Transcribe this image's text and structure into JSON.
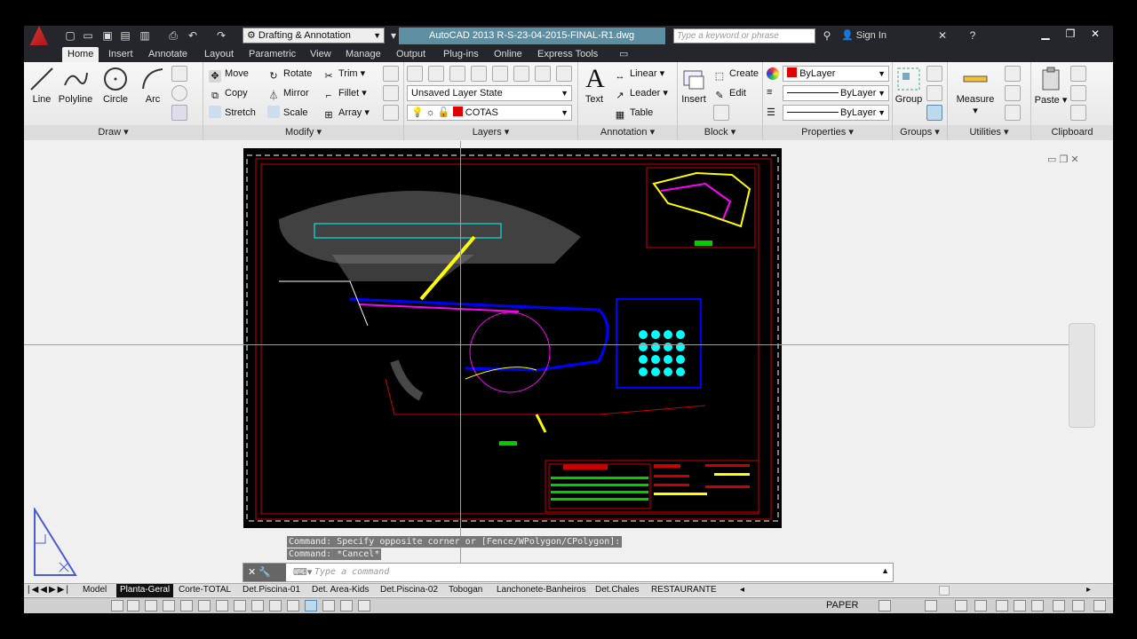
{
  "titlebar": {
    "workspace": "Drafting & Annotation",
    "app_title": "AutoCAD 2013   R-S-23-04-2015-FINAL-R1.dwg",
    "search_placeholder": "Type a keyword or phrase",
    "signin": "Sign In"
  },
  "tabs": [
    "Home",
    "Insert",
    "Annotate",
    "Layout",
    "Parametric",
    "View",
    "Manage",
    "Output",
    "Plug-ins",
    "Online",
    "Express Tools"
  ],
  "ribbon": {
    "draw": {
      "title": "Draw",
      "line": "Line",
      "polyline": "Polyline",
      "circle": "Circle",
      "arc": "Arc"
    },
    "modify": {
      "title": "Modify",
      "move": "Move",
      "rotate": "Rotate",
      "trim": "Trim",
      "copy": "Copy",
      "mirror": "Mirror",
      "fillet": "Fillet",
      "stretch": "Stretch",
      "scale": "Scale",
      "array": "Array"
    },
    "layers": {
      "title": "Layers",
      "layer_state": "Unsaved Layer State",
      "current_layer": "COTAS"
    },
    "annotation": {
      "title": "Annotation",
      "text": "Text",
      "linear": "Linear",
      "leader": "Leader",
      "table": "Table"
    },
    "block": {
      "title": "Block",
      "insert": "Insert",
      "create": "Create",
      "edit": "Edit"
    },
    "properties": {
      "title": "Properties",
      "color": "ByLayer",
      "linetype": "ByLayer",
      "lineweight": "ByLayer"
    },
    "groups": {
      "title": "Groups",
      "group": "Group"
    },
    "utilities": {
      "title": "Utilities",
      "measure": "Measure"
    },
    "clipboard": {
      "title": "Clipboard",
      "paste": "Paste"
    }
  },
  "history": [
    "Command: Specify opposite corner or [Fence/WPolygon/CPolygon]:",
    "Command: *Cancel*"
  ],
  "command": {
    "placeholder": "Type a command"
  },
  "layout_tabs": [
    "Model",
    "Planta-Geral",
    "Corte-TOTAL",
    "Det.Piscina-01",
    "Det. Area-Kids",
    "Det.Piscina-02",
    "Tobogan",
    "Lanchonete-Banheiros",
    "Det.Chales",
    "RESTAURANTE"
  ],
  "active_layout": "Planta-Geral",
  "status": {
    "space": "PAPER"
  },
  "colors": {
    "accent": "#5d8fa3",
    "titlebar": "#25262b",
    "drawing_bg": "#000000",
    "layer_color": "#e00000"
  }
}
